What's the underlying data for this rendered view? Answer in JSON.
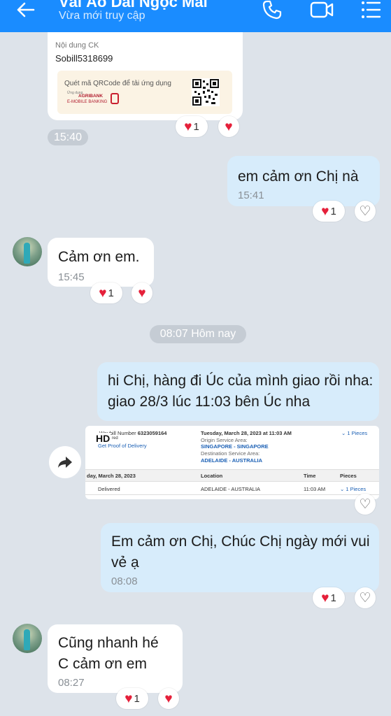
{
  "header": {
    "title": "Vải Áo Dài Ngọc Mai",
    "status": "Vừa mới truy cập",
    "icons": [
      "back-arrow-icon",
      "phone-icon",
      "video-call-icon",
      "menu-list-icon"
    ]
  },
  "transfer_card": {
    "content_label": "Nội dung CK",
    "content_value": "Sobill5318699",
    "qr_note": "Quét mã QRCode để tải ứng dụng",
    "bank_small": "Ứng dụng",
    "bank_name": "AGRIBANK",
    "bank_app": "E-MOBILE BANKING",
    "reaction_count": "1",
    "time": "15:40"
  },
  "messages": [
    {
      "side": "out",
      "text": "em cảm ơn Chị nà",
      "time": "15:41",
      "reaction_count": "1"
    },
    {
      "side": "in",
      "text": "Cảm ơn em.",
      "time": "15:45",
      "reaction_count": "1"
    },
    {
      "side": "out",
      "text": "hi Chị, hàng đi Úc của mình giao rồi nha: giao 28/3 lúc 11:03 bên Úc nha",
      "time": ""
    },
    {
      "side": "out",
      "text": "Em cảm ơn Chị, Chúc Chị ngày mới vui vẻ ạ",
      "time": "08:08",
      "reaction_count": "1"
    },
    {
      "side": "in",
      "text": "Cũng nhanh hé\nC cảm ơn em",
      "time": "08:27",
      "reaction_count": "1"
    }
  ],
  "date_separator": "08:07 Hôm nay",
  "delivery_image": {
    "waybill_label": "Waybill Number",
    "waybill_number": "6323059164",
    "hd_badge": "HD",
    "red_label": "red",
    "proof_link": "Get Proof of Delivery",
    "date_time": "Tuesday, March 28, 2023 at 11:03 AM",
    "pieces_top": "1 Pieces",
    "origin_label": "Origin Service Area:",
    "origin_value": "SINGAPORE - SINGAPORE",
    "dest_label": "Destination Service Area:",
    "dest_value": "ADELAIDE - AUSTRALIA",
    "row_date": "day, March 28, 2023",
    "col_location": "Location",
    "col_time": "Time",
    "col_pieces": "Pieces",
    "status": "Delivered",
    "location": "ADELAIDE - AUSTRALIA",
    "time": "11:03 AM",
    "pieces": "1 Pieces"
  },
  "colors": {
    "header": "#1a8cff",
    "outgoing": "#d7ecfb",
    "incoming": "#ffffff",
    "background": "#dde3ea",
    "heart": "#e5203a"
  }
}
